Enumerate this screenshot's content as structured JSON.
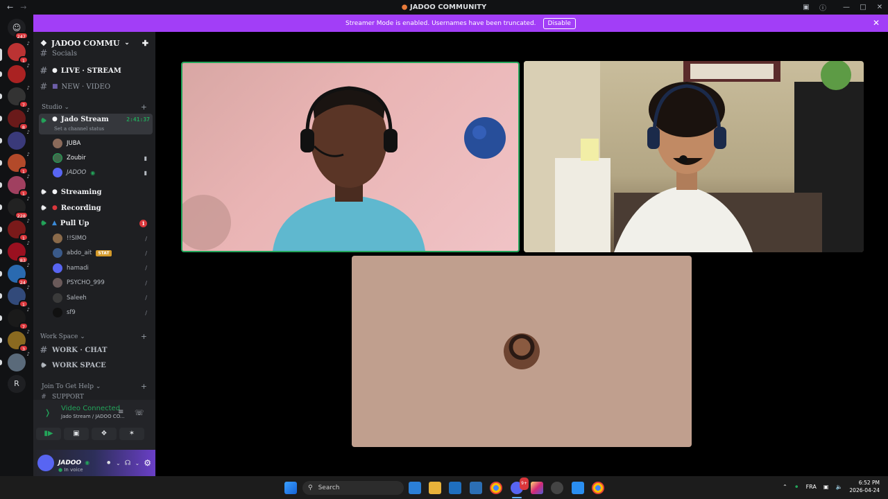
{
  "window": {
    "title": "JADOO COMMUNITY",
    "back_icon": "arrow-left-icon",
    "forward_icon": "arrow-right-icon"
  },
  "banner": {
    "text": "Streamer Mode is enabled. Usernames have been truncated.",
    "button": "Disable",
    "color": "#a23ef7"
  },
  "rail": {
    "home_badge": "247",
    "servers": [
      {
        "badge": "1"
      },
      {
        "badge": ""
      },
      {
        "badge": "7"
      },
      {
        "badge": "8"
      },
      {
        "badge": ""
      },
      {
        "badge": "1"
      },
      {
        "badge": "1"
      },
      {
        "badge": "228"
      },
      {
        "badge": "1"
      },
      {
        "badge": "83"
      },
      {
        "badge": "24"
      },
      {
        "badge": "1"
      },
      {
        "badge": "7"
      },
      {
        "badge": "3"
      },
      {
        "badge": ""
      }
    ],
    "letter_server": "R"
  },
  "sidebar": {
    "guild_name": "JADOO COMMUN...",
    "channels": {
      "socials": "Socials",
      "live_stream": "LIVE · STREAM",
      "new_video": "NEW · VIDEO"
    },
    "cat_studio": "Studio",
    "jado_stream": {
      "name": "Jado Stream",
      "timer": "2:41:37",
      "status": "Set a channel status"
    },
    "jado_users": [
      "JUBA",
      "Zoubir",
      "JADOO"
    ],
    "streaming": "Streaming",
    "recording": "Recording",
    "pull_up": {
      "name": "Pull Up",
      "badge": "1"
    },
    "pull_up_users": [
      "!!SIMO",
      "abdo_ait",
      "hamadi",
      "PSYCHO_999",
      "Saleeh",
      "sf9"
    ],
    "stat_tag": "STAT",
    "cat_workspace": "Work Space",
    "work_chat": "WORK · CHAT",
    "work_space": "WORK SPACE",
    "cat_help": "Join To Get Help",
    "support": "SUPPORT"
  },
  "panel": {
    "connected": "Video Connected",
    "channel": "Jado Stream / JADOO CO...",
    "user": "JADOO",
    "user_status": "In voice"
  },
  "taskbar": {
    "search": "Search",
    "lang": "FRA",
    "time": "6:52 PM",
    "date": "2026-04-24",
    "discord_badge": "9+"
  }
}
